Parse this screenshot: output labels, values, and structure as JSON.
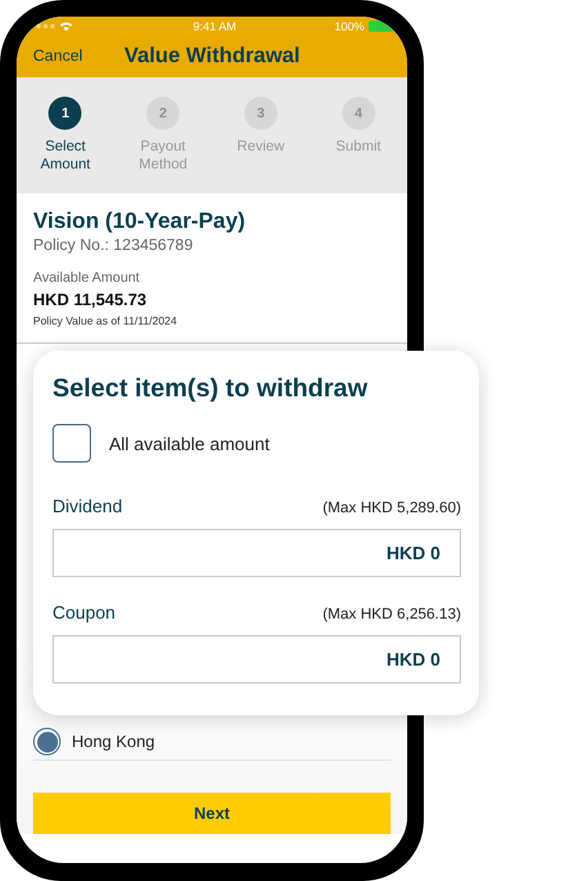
{
  "status_bar": {
    "time": "9:41 AM",
    "battery": "100%"
  },
  "header": {
    "cancel": "Cancel",
    "title": "Value Withdrawal"
  },
  "steps": [
    {
      "number": "1",
      "label": "Select Amount",
      "selected": true
    },
    {
      "number": "2",
      "label": "Payout Method",
      "selected": false
    },
    {
      "number": "3",
      "label": "Review",
      "selected": false
    },
    {
      "number": "4",
      "label": "Submit",
      "selected": false
    }
  ],
  "policy": {
    "name": "Vision (10-Year-Pay)",
    "number": "Policy No.: 123456789",
    "available_label": "Available Amount",
    "available_amount": "HKD 11,545.73",
    "value_note": "Policy Value as of 11/11/2024"
  },
  "region_option": {
    "label": "Hong Kong",
    "selected": true
  },
  "next_button": "Next",
  "popup": {
    "title": "Select item(s) to withdraw",
    "all_amount": {
      "label": "All available amount",
      "checked": false
    },
    "items": [
      {
        "label": "Dividend",
        "max": "(Max HKD 5,289.60)",
        "value": "HKD 0"
      },
      {
        "label": "Coupon",
        "max": "(Max HKD 6,256.13)",
        "value": "HKD 0"
      }
    ]
  }
}
